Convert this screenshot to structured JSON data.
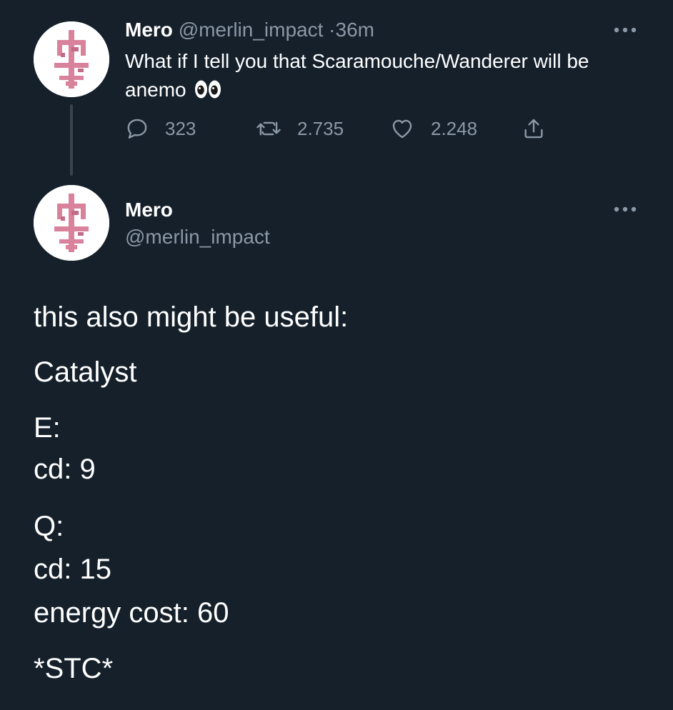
{
  "tweet1": {
    "name": "Mero",
    "handle": "@merlin_impact",
    "separator": "·",
    "time": "36m",
    "text": "What if I tell you that Scaramouche/Wanderer will be anemo",
    "emoji_icon": "eyes-emoji",
    "replies": "323",
    "retweets": "2.735",
    "likes": "2.248"
  },
  "tweet2": {
    "name": "Mero",
    "handle": "@merlin_impact",
    "lines": [
      "this also might be useful:",
      "Catalyst",
      "E:",
      "cd: 9",
      "Q:",
      "cd: 15",
      "energy cost: 60",
      "*STC*"
    ]
  },
  "icons": {
    "reply": "reply-icon",
    "retweet": "retweet-icon",
    "like": "heart-icon",
    "share": "share-icon",
    "more": "more-icon"
  },
  "colors": {
    "background": "#15202b",
    "text": "#ffffff",
    "muted": "#8b98a5",
    "avatar_mark": "#d9829b",
    "thread_line": "#38444d"
  }
}
